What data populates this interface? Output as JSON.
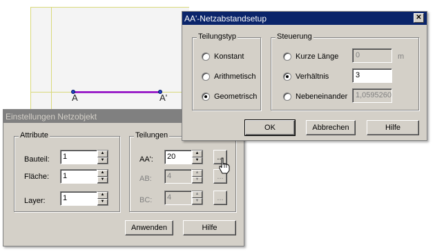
{
  "canvas": {
    "point_a": "A",
    "point_a_prime": "A'"
  },
  "netz_dialog": {
    "title": "AA'-Netzabstandsetup",
    "close_glyph": "✕",
    "teilungstyp": {
      "label": "Teilungstyp",
      "options": [
        "Konstant",
        "Arithmetisch",
        "Geometrisch"
      ],
      "selected": "Geometrisch"
    },
    "steuerung": {
      "label": "Steuerung",
      "kurze_laenge": {
        "label": "Kurze Länge",
        "value": "0",
        "unit": "m"
      },
      "verhaeltnis": {
        "label": "Verhältnis",
        "value": "3"
      },
      "nebeneinander": {
        "label": "Nebeneinander",
        "value": "1,0595260"
      },
      "selected": "Verhältnis"
    },
    "buttons": {
      "ok": "OK",
      "cancel": "Abbrechen",
      "help": "Hilfe"
    }
  },
  "einstellungen_dialog": {
    "title": "Einstellungen Netzobjekt",
    "attribute": {
      "label": "Attribute",
      "bauteil": {
        "label": "Bauteil:",
        "value": "1"
      },
      "flaeche": {
        "label": "Fläche:",
        "value": "1"
      },
      "layer": {
        "label": "Layer:",
        "value": "1"
      }
    },
    "teilungen": {
      "label": "Teilungen",
      "aa": {
        "label": "AA':",
        "value": "20"
      },
      "ab": {
        "label": "AB:",
        "value": "4"
      },
      "bc": {
        "label": "BC:",
        "value": "4"
      },
      "more_glyph": "..."
    },
    "buttons": {
      "apply": "Anwenden",
      "help": "Hilfe"
    }
  },
  "colors": {
    "active_title": "#0a246a",
    "inactive_title": "#808080",
    "edge": "#9a22c8",
    "dialog_bg": "#d4d0c8"
  },
  "cursor_icon": "hand-pointer-icon"
}
